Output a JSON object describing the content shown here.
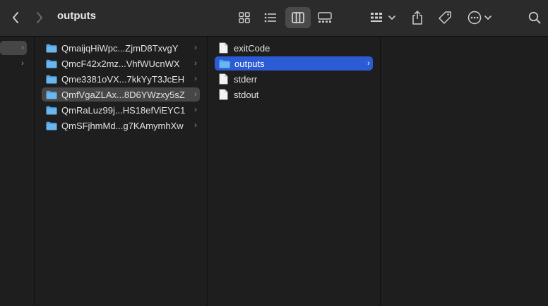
{
  "window": {
    "title": "outputs"
  },
  "toolbar": {
    "back_icon": "chevron-left-icon",
    "forward_icon": "chevron-right-icon",
    "views": [
      {
        "name": "icon-view-icon",
        "active": false
      },
      {
        "name": "list-view-icon",
        "active": false
      },
      {
        "name": "column-view-icon",
        "active": true
      },
      {
        "name": "gallery-view-icon",
        "active": false
      }
    ],
    "group_icon": "group-by-icon",
    "share_icon": "share-icon",
    "tag_icon": "tag-icon",
    "more_icon": "more-actions-icon",
    "search_icon": "search-icon"
  },
  "column2": {
    "items": [
      {
        "label": "QmaijqHiWpc...ZjmD8TxvgY",
        "type": "folder",
        "selected": false
      },
      {
        "label": "QmcF42x2mz...VhfWUcnWX",
        "type": "folder",
        "selected": false
      },
      {
        "label": "Qme3381oVX...7kkYyT3JcEH",
        "type": "folder",
        "selected": false
      },
      {
        "label": "QmfVgaZLAx...8D6YWzxy5sZ",
        "type": "folder",
        "selected": true
      },
      {
        "label": "QmRaLuz99j...HS18efViEYC1",
        "type": "folder",
        "selected": false
      },
      {
        "label": "QmSFjhmMd...g7KAmymhXw",
        "type": "folder",
        "selected": false
      }
    ]
  },
  "column3": {
    "items": [
      {
        "label": "exitCode",
        "type": "file"
      },
      {
        "label": "outputs",
        "type": "folder",
        "selected": true
      },
      {
        "label": "stderr",
        "type": "file"
      },
      {
        "label": "stdout",
        "type": "file"
      }
    ]
  },
  "colors": {
    "toolbar_bg": "#2b2b2b",
    "column_bg": "#1e1e1e",
    "selection_active": "#2b5cd6",
    "selection_inactive": "#464646",
    "folder_blue": "#4fa3e6"
  }
}
